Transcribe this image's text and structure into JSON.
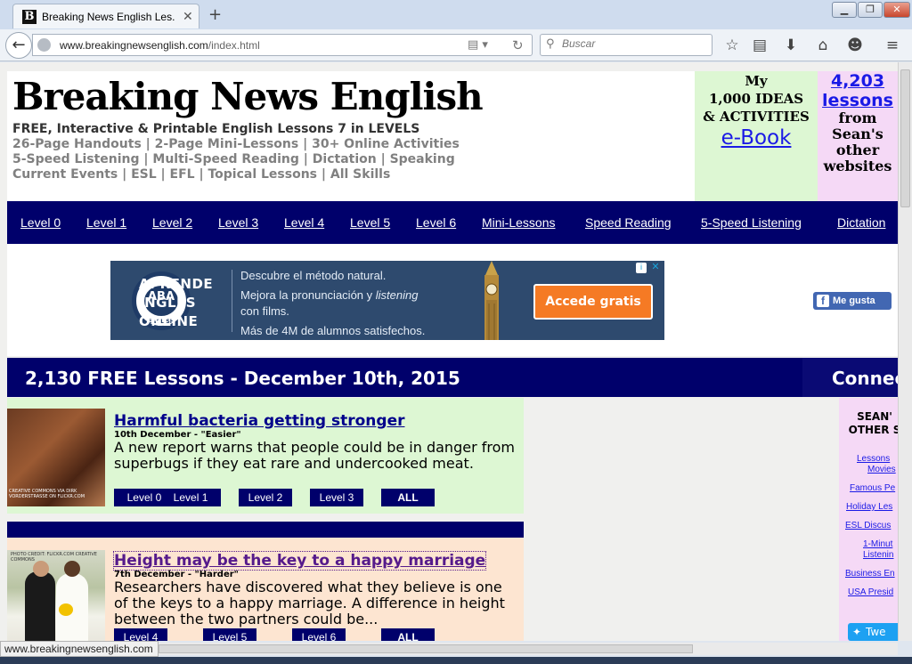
{
  "browser": {
    "tab_title": "Breaking News English Les...",
    "tab_favicon": "B",
    "new_tab": "+",
    "url_domain": "www.breakingnewsenglish.com",
    "url_path": "/index.html",
    "search_placeholder": "Buscar",
    "status_text": "www.breakingnewsenglish.com",
    "icons": [
      "back-arrow-icon",
      "globe-icon",
      "reader-view-icon",
      "reload-icon",
      "search-icon",
      "bookmark-star-icon",
      "bookmarks-list-icon",
      "download-icon",
      "home-icon",
      "chat-icon",
      "hamburger-menu-icon"
    ]
  },
  "header": {
    "title": "Breaking News English",
    "tagline": "FREE, Interactive & Printable English Lessons 7 in LEVELS",
    "lines": [
      "26-Page Handouts | 2-Page Mini-Lessons | 30+ Online Activities",
      "5-Speed Listening | Multi-Speed Reading | Dictation | Speaking",
      "Current Events | ESL | EFL | Topical Lessons | All Skills"
    ],
    "ebook": {
      "line1": "My",
      "line2": "1,000 IDEAS",
      "line3": "& ACTIVITIES",
      "link": "e-Book"
    },
    "lessons_box": {
      "number": "4,203",
      "link": "lessons",
      "line1": "from",
      "line2": "Sean's",
      "line3": "other",
      "line4": "websites"
    }
  },
  "nav": [
    "Level 0",
    "Level 1",
    "Level 2",
    "Level 3",
    "Level 4",
    "Level 5",
    "Level 6",
    "Mini-Lessons",
    "Speed Reading",
    "5-Speed Listening",
    "Dictation"
  ],
  "ad": {
    "badge": "ABA",
    "badge_sub": "ENGLISH",
    "headline_1": "APRENDE",
    "headline_2": "INGLÉS",
    "headline_3": "ONLINE",
    "body_1": "Descubre el método natural.",
    "body_2": "Mejora la pronunciación y",
    "body_2_em": "listening",
    "body_3": "con films.",
    "body_4": "Más de 4M de alumnos satisfechos.",
    "cta": "Accede gratis"
  },
  "facebook": {
    "like": "Me gusta"
  },
  "date_bar": {
    "title": "2,130 FREE Lessons - December 10th, 2015",
    "connect": "Connect"
  },
  "lessons": [
    {
      "title": "Harmful bacteria getting stronger",
      "date": "10th December - \"Easier\"",
      "desc": "A new report warns that people could be in danger from superbugs if they eat rare and undercooked meat.",
      "thumb_caption": "CREATIVE COMMONS VIA DIRK VORDERSTRASSE ON FLICKR.COM",
      "buttons": [
        "Level 0",
        "Level 1",
        "Level 2",
        "Level 3",
        "ALL"
      ]
    },
    {
      "title": "Height may be the key to a happy marriage",
      "date": "7th December - \"Harder\"",
      "desc": "Researchers have discovered what they believe is one of the keys to a happy marriage. A difference in height between the two partners could be...",
      "thumb_caption": "PHOTO CREDIT: FLICKR.COM CREATIVE COMMONS",
      "buttons": [
        "Level 4",
        "Level 5",
        "Level 6",
        "ALL"
      ]
    }
  ],
  "sidebar": {
    "heading_1": "SEAN'",
    "heading_2": "OTHER S",
    "links": [
      "Lessons",
      "Movies",
      "Famous Pe",
      "Holiday Les",
      "ESL Discus",
      "1-Minut",
      "Listenin",
      "Business En",
      "USA Presid"
    ],
    "tweet": "Twe"
  }
}
